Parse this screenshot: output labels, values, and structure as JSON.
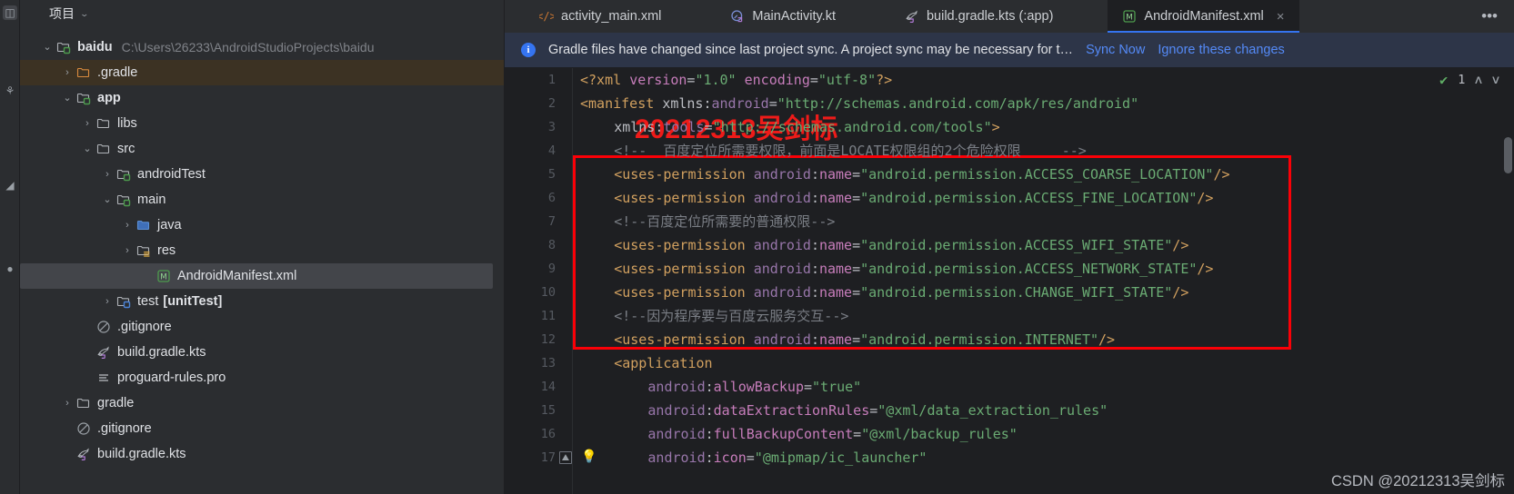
{
  "toolstrip": {
    "icons": [
      {
        "name": "project-tool-icon",
        "glyph": "▧"
      },
      {
        "name": "commit-tool-icon",
        "glyph": "⎇"
      },
      {
        "name": "structure-tool-icon",
        "glyph": "◧"
      },
      {
        "name": "bookmarks-tool-icon",
        "glyph": "●"
      }
    ]
  },
  "sidebar": {
    "title": "项目",
    "title_chevron": "⌄",
    "tree": [
      {
        "indent": 0,
        "arrow": "⌄",
        "icon": "module-folder-icon",
        "label": "baidu",
        "bold": true,
        "note": "C:\\Users\\26233\\AndroidStudioProjects\\baidu",
        "highlight": "none"
      },
      {
        "indent": 1,
        "arrow": "›",
        "icon": "folder-orange-icon",
        "label": ".gradle",
        "bold": false,
        "note": "",
        "highlight": "brown"
      },
      {
        "indent": 1,
        "arrow": "⌄",
        "icon": "module-folder-icon",
        "label": "app",
        "bold": true,
        "note": "",
        "highlight": "none"
      },
      {
        "indent": 2,
        "arrow": "›",
        "icon": "folder-grey-icon",
        "label": "libs",
        "bold": false,
        "note": "",
        "highlight": "none"
      },
      {
        "indent": 2,
        "arrow": "⌄",
        "icon": "folder-grey-icon",
        "label": "src",
        "bold": false,
        "note": "",
        "highlight": "none"
      },
      {
        "indent": 3,
        "arrow": "›",
        "icon": "source-folder-icon",
        "label": "androidTest",
        "bold": false,
        "note": "",
        "highlight": "none"
      },
      {
        "indent": 3,
        "arrow": "⌄",
        "icon": "source-folder-icon",
        "label": "main",
        "bold": false,
        "note": "",
        "highlight": "none"
      },
      {
        "indent": 4,
        "arrow": "›",
        "icon": "folder-blue-icon",
        "label": "java",
        "bold": false,
        "note": "",
        "highlight": "none"
      },
      {
        "indent": 4,
        "arrow": "›",
        "icon": "res-folder-icon",
        "label": "res",
        "bold": false,
        "note": "",
        "highlight": "none"
      },
      {
        "indent": 5,
        "arrow": "",
        "icon": "manifest-file-icon",
        "label": "AndroidManifest.xml",
        "bold": false,
        "note": "",
        "highlight": "grey"
      },
      {
        "indent": 3,
        "arrow": "›",
        "icon": "test-folder-icon",
        "label": "test",
        "bold": false,
        "note": "",
        "sub": "[unitTest]",
        "highlight": "none"
      },
      {
        "indent": 2,
        "arrow": "",
        "icon": "gitignore-icon",
        "label": ".gitignore",
        "bold": false,
        "note": "",
        "highlight": "none"
      },
      {
        "indent": 2,
        "arrow": "",
        "icon": "gradle-kts-icon",
        "label": "build.gradle.kts",
        "bold": false,
        "note": "",
        "highlight": "none"
      },
      {
        "indent": 2,
        "arrow": "",
        "icon": "proguard-icon",
        "label": "proguard-rules.pro",
        "bold": false,
        "note": "",
        "highlight": "none"
      },
      {
        "indent": 1,
        "arrow": "›",
        "icon": "folder-grey-icon",
        "label": "gradle",
        "bold": false,
        "note": "",
        "highlight": "none"
      },
      {
        "indent": 1,
        "arrow": "",
        "icon": "gitignore-icon",
        "label": ".gitignore",
        "bold": false,
        "note": "",
        "highlight": "none"
      },
      {
        "indent": 1,
        "arrow": "",
        "icon": "gradle-kts-icon",
        "label": "build.gradle.kts",
        "bold": false,
        "note": "",
        "highlight": "none"
      }
    ]
  },
  "tabs": [
    {
      "label": "activity_main.xml",
      "icon": "xml-layout-icon",
      "active": false,
      "closable": false
    },
    {
      "label": "MainActivity.kt",
      "icon": "kotlin-class-icon",
      "active": false,
      "closable": false
    },
    {
      "label": "build.gradle.kts (:app)",
      "icon": "gradle-kts-icon",
      "active": false,
      "closable": false
    },
    {
      "label": "AndroidManifest.xml",
      "icon": "manifest-file-icon",
      "active": true,
      "closable": true
    }
  ],
  "tabbar": {
    "close_glyph": "×",
    "overflow_menu_name": "more-options"
  },
  "banner": {
    "message": "Gradle files have changed since last project sync. A project sync may be necessary for t…",
    "info_glyph": "i",
    "actions": [
      {
        "label": "Sync Now"
      },
      {
        "label": "Ignore these changes"
      }
    ]
  },
  "inspection_widget": {
    "check_glyph": "✔",
    "count": "1",
    "up_glyph": "∧",
    "down_glyph": "∨"
  },
  "editor": {
    "lines": [
      {
        "num": "1",
        "indent": 0,
        "tokens": [
          {
            "c": "t-tag",
            "t": "<?xml "
          },
          {
            "c": "t-attr",
            "t": "version"
          },
          {
            "c": "t-eq",
            "t": "="
          },
          {
            "c": "t-val",
            "t": "\"1.0\""
          },
          {
            "c": "t-plain",
            "t": " "
          },
          {
            "c": "t-attr",
            "t": "encoding"
          },
          {
            "c": "t-eq",
            "t": "="
          },
          {
            "c": "t-val",
            "t": "\"utf-8\""
          },
          {
            "c": "t-tag",
            "t": "?>"
          }
        ]
      },
      {
        "num": "2",
        "indent": 0,
        "tokens": [
          {
            "c": "t-tag",
            "t": "<manifest "
          },
          {
            "c": "t-plain",
            "t": "xmlns:"
          },
          {
            "c": "t-ns",
            "t": "android"
          },
          {
            "c": "t-eq",
            "t": "="
          },
          {
            "c": "t-val",
            "t": "\"http://schemas.android.com/apk/res/android\""
          }
        ]
      },
      {
        "num": "3",
        "indent": 1,
        "tokens": [
          {
            "c": "t-plain",
            "t": "xmlns:"
          },
          {
            "c": "t-ns",
            "t": "tools"
          },
          {
            "c": "t-eq",
            "t": "="
          },
          {
            "c": "t-val",
            "t": "\"http://schemas.android.com/tools\""
          },
          {
            "c": "t-tag",
            "t": ">"
          }
        ]
      },
      {
        "num": "4",
        "indent": 1,
        "tokens": [
          {
            "c": "t-cmt",
            "t": "<!--  百度定位所需要权限，前面是LOCATE权限组的2个危险权限     -->"
          }
        ]
      },
      {
        "num": "5",
        "indent": 1,
        "tokens": [
          {
            "c": "t-tag",
            "t": "<uses-permission "
          },
          {
            "c": "t-ns",
            "t": "android"
          },
          {
            "c": "t-plain",
            "t": ":"
          },
          {
            "c": "t-attr",
            "t": "name"
          },
          {
            "c": "t-eq",
            "t": "="
          },
          {
            "c": "t-val",
            "t": "\"android.permission.ACCESS_COARSE_LOCATION\""
          },
          {
            "c": "t-tag",
            "t": "/>"
          }
        ]
      },
      {
        "num": "6",
        "indent": 1,
        "tokens": [
          {
            "c": "t-tag",
            "t": "<uses-permission "
          },
          {
            "c": "t-ns",
            "t": "android"
          },
          {
            "c": "t-plain",
            "t": ":"
          },
          {
            "c": "t-attr",
            "t": "name"
          },
          {
            "c": "t-eq",
            "t": "="
          },
          {
            "c": "t-val",
            "t": "\"android.permission.ACCESS_FINE_LOCATION\""
          },
          {
            "c": "t-tag",
            "t": "/>"
          }
        ]
      },
      {
        "num": "7",
        "indent": 1,
        "tokens": [
          {
            "c": "t-cmt",
            "t": "<!--百度定位所需要的普通权限-->"
          }
        ]
      },
      {
        "num": "8",
        "indent": 1,
        "tokens": [
          {
            "c": "t-tag",
            "t": "<uses-permission "
          },
          {
            "c": "t-ns",
            "t": "android"
          },
          {
            "c": "t-plain",
            "t": ":"
          },
          {
            "c": "t-attr",
            "t": "name"
          },
          {
            "c": "t-eq",
            "t": "="
          },
          {
            "c": "t-val",
            "t": "\"android.permission.ACCESS_WIFI_STATE\""
          },
          {
            "c": "t-tag",
            "t": "/>"
          }
        ]
      },
      {
        "num": "9",
        "indent": 1,
        "tokens": [
          {
            "c": "t-tag",
            "t": "<uses-permission "
          },
          {
            "c": "t-ns",
            "t": "android"
          },
          {
            "c": "t-plain",
            "t": ":"
          },
          {
            "c": "t-attr",
            "t": "name"
          },
          {
            "c": "t-eq",
            "t": "="
          },
          {
            "c": "t-val",
            "t": "\"android.permission.ACCESS_NETWORK_STATE\""
          },
          {
            "c": "t-tag",
            "t": "/>"
          }
        ]
      },
      {
        "num": "10",
        "indent": 1,
        "tokens": [
          {
            "c": "t-tag",
            "t": "<uses-permission "
          },
          {
            "c": "t-ns",
            "t": "android"
          },
          {
            "c": "t-plain",
            "t": ":"
          },
          {
            "c": "t-attr",
            "t": "name"
          },
          {
            "c": "t-eq",
            "t": "="
          },
          {
            "c": "t-val",
            "t": "\"android.permission.CHANGE_WIFI_STATE\""
          },
          {
            "c": "t-tag",
            "t": "/>"
          }
        ]
      },
      {
        "num": "11",
        "indent": 1,
        "tokens": [
          {
            "c": "t-cmt",
            "t": "<!--因为程序要与百度云服务交互-->"
          }
        ]
      },
      {
        "num": "12",
        "indent": 1,
        "tokens": [
          {
            "c": "t-tag",
            "t": "<uses-permission "
          },
          {
            "c": "t-ns",
            "t": "android"
          },
          {
            "c": "t-plain",
            "t": ":"
          },
          {
            "c": "t-attr",
            "t": "name"
          },
          {
            "c": "t-eq",
            "t": "="
          },
          {
            "c": "t-val",
            "t": "\"android.permission.INTERNET\""
          },
          {
            "c": "t-tag",
            "t": "/>"
          }
        ]
      },
      {
        "num": "13",
        "indent": 1,
        "tokens": [
          {
            "c": "t-tag",
            "t": "<application"
          }
        ]
      },
      {
        "num": "14",
        "indent": 2,
        "tokens": [
          {
            "c": "t-ns",
            "t": "android"
          },
          {
            "c": "t-plain",
            "t": ":"
          },
          {
            "c": "t-attr",
            "t": "allowBackup"
          },
          {
            "c": "t-eq",
            "t": "="
          },
          {
            "c": "t-val",
            "t": "\"true\""
          }
        ]
      },
      {
        "num": "15",
        "indent": 2,
        "tokens": [
          {
            "c": "t-ns",
            "t": "android"
          },
          {
            "c": "t-plain",
            "t": ":"
          },
          {
            "c": "t-attr",
            "t": "dataExtractionRules"
          },
          {
            "c": "t-eq",
            "t": "="
          },
          {
            "c": "t-val",
            "t": "\"@xml/data_extraction_rules\""
          }
        ]
      },
      {
        "num": "16",
        "indent": 2,
        "tokens": [
          {
            "c": "t-ns",
            "t": "android"
          },
          {
            "c": "t-plain",
            "t": ":"
          },
          {
            "c": "t-attr",
            "t": "fullBackupContent"
          },
          {
            "c": "t-eq",
            "t": "="
          },
          {
            "c": "t-val",
            "t": "\"@xml/backup_rules\""
          }
        ]
      },
      {
        "num": "17",
        "indent": 2,
        "tokens": [
          {
            "c": "t-ns",
            "t": "android"
          },
          {
            "c": "t-plain",
            "t": ":"
          },
          {
            "c": "t-attr",
            "t": "icon"
          },
          {
            "c": "t-eq",
            "t": "="
          },
          {
            "c": "t-val",
            "t": "\"@mipmap/ic_launcher\""
          }
        ]
      }
    ],
    "gutter_marks": [
      {
        "line": "17",
        "glyph": "⛰",
        "name": "image-resource-gutter-icon"
      }
    ],
    "bulb": {
      "line": "17",
      "glyph": "Ὂ1",
      "name": "intention-bulb-icon"
    }
  },
  "annotations": {
    "red_watermark": "20212313吴剑标",
    "red_box_name": "red-highlight-rectangle"
  },
  "watermark": {
    "text": "CSDN @20212313吴剑标"
  },
  "colors": {
    "accent_blue": "#3574f0",
    "link_blue": "#548af7",
    "annotation_red": "#fb0007",
    "banner_bg": "#2d3548",
    "editor_bg": "#1e1f22",
    "panel_bg": "#2b2d30"
  }
}
